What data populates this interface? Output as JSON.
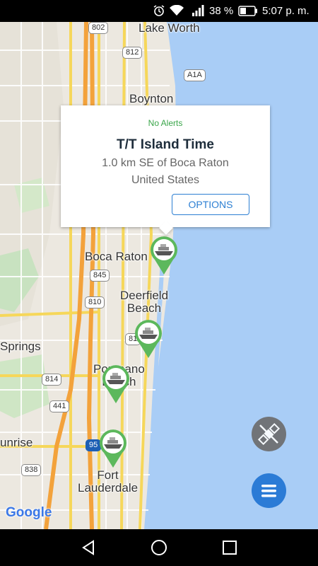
{
  "status_bar": {
    "battery_percent": "38 %",
    "time": "5:07 p. m.",
    "icons": [
      "alarm-icon",
      "wifi-icon",
      "signal-icon",
      "battery-icon"
    ]
  },
  "map": {
    "place_labels": {
      "lake_worth": "Lake Worth",
      "boynton": "Boynton",
      "boca_raton": "Boca Raton",
      "deerfield_beach": "Deerfield\nBeach",
      "springs": "Springs",
      "pompano_beach": "Pompano\nBeach",
      "sunrise": "unrise",
      "fort_lauderdale": "Fort\nLauderdale"
    },
    "road_shields": {
      "r802": "802",
      "r812": "812",
      "a1a": "A1A",
      "r845": "845",
      "r810": "810",
      "r81": "81",
      "r814": "814",
      "r441": "441",
      "i95": "95",
      "r838": "838"
    },
    "attribution": "Google"
  },
  "popup": {
    "alerts": "No Alerts",
    "vessel_name": "T/T Island Time",
    "location": "1.0 km SE of Boca Raton",
    "country": "United States",
    "options_label": "OPTIONS"
  },
  "colors": {
    "water": "#a9cdf6",
    "pin_green": "#5cb85c",
    "fab_blue": "#2b7bd6",
    "fab_grey": "#6b6b6b"
  },
  "fabs": {
    "satellite": "satellite-icon",
    "menu": "menu-icon"
  }
}
